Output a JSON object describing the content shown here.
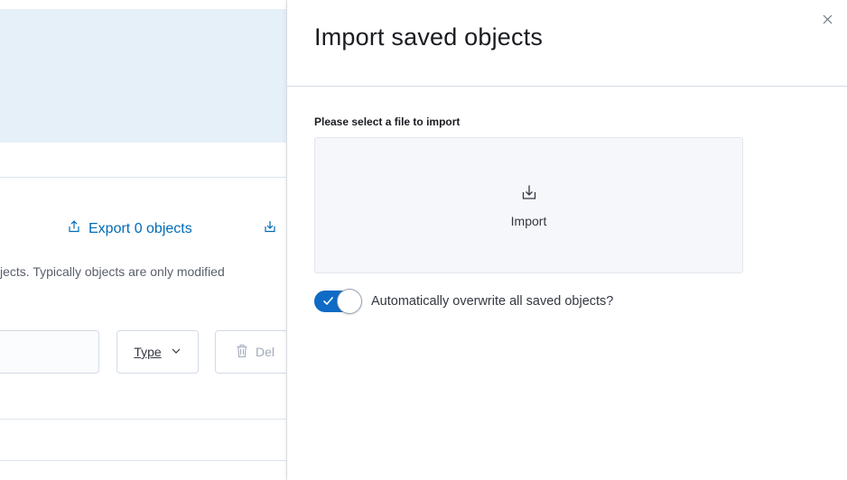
{
  "background": {
    "export_label": "Export 0 objects",
    "description": "jects. Typically objects are only modified",
    "type_filter_label": "Type",
    "delete_label": "Del"
  },
  "flyout": {
    "title": "Import saved objects",
    "file_label": "Please select a file to import",
    "file_picker_text": "Import",
    "overwrite_label": "Automatically overwrite all saved objects?",
    "overwrite_enabled": true
  },
  "colors": {
    "accent": "#006bb8",
    "switch_on": "#0f6bc6",
    "header_bg": "#e6f0f8"
  },
  "icons": {
    "export": "upload-icon",
    "import": "download-tray-icon",
    "close": "close-icon",
    "type_dropdown": "chevron-down-icon",
    "delete": "trash-icon",
    "switch": "check-icon"
  }
}
